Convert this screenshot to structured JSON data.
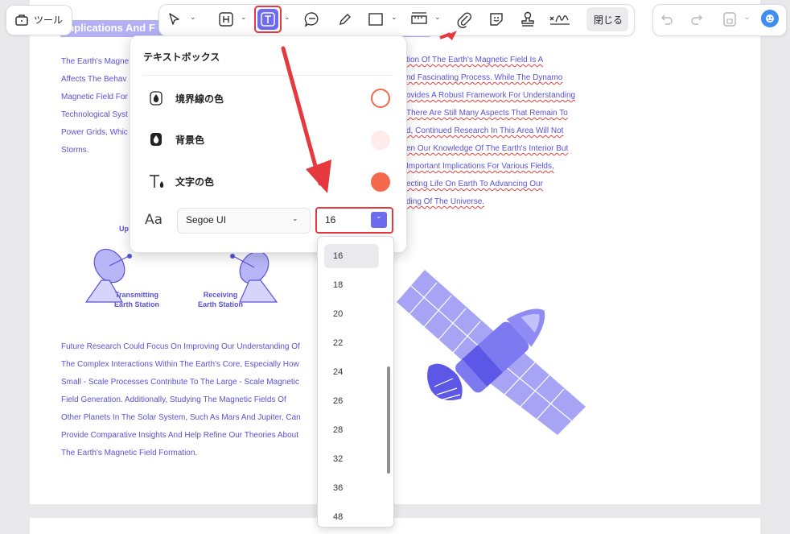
{
  "toolbar": {
    "tools_label": "ツール",
    "close_label": "閉じる"
  },
  "document": {
    "heading": "Implications And F",
    "left_para": [
      "The Earth's Magne",
      "Affects The Behav",
      "Magnetic Field For",
      "Technological Syst",
      "Power Grids, Whic",
      "Storms."
    ],
    "right_para": [
      "tion Of The Earth's Magnetic Field Is A",
      "nd Fascinating Process. While The Dynamo",
      "ovides A Robust Framework For Understanding",
      "There Are Still Many Aspects That Remain To",
      "d, Continued Research In This Area Will Not",
      "en Our Knowledge Of The Earth's Interior But",
      "Important Implications For Various Fields,",
      "ecting Life On Earth To Advancing Our",
      "ding Of The Universe."
    ],
    "diagram_top": "Up",
    "transmitting_label": [
      "Transmitting",
      "Earth Station"
    ],
    "receiving_label": [
      "Receiving",
      "Earth Station"
    ],
    "bottom_para": [
      "Future Research Could Focus On Improving Our Understanding Of",
      "The Complex Interactions Within The Earth's Core, Especially How",
      "Small - Scale Processes Contribute To The Large - Scale Magnetic",
      "Field Generation. Additionally, Studying The Magnetic Fields Of",
      "Other Planets In The Solar System, Such As Mars And Jupiter, Can",
      "Provide Comparative Insights And Help Refine Our Theories About",
      "The Earth's Magnetic Field Formation."
    ]
  },
  "textbox_panel": {
    "title": "テキストボックス",
    "border_color_label": "境界線の色",
    "background_color_label": "背景色",
    "text_color_label": "文字の色",
    "font_name": "Segoe UI",
    "font_size": "16",
    "colors": {
      "border": "#f26a4b",
      "background": "#fdeceb",
      "text": "#f26a4b"
    }
  },
  "font_size_options": [
    "16",
    "18",
    "20",
    "22",
    "24",
    "26",
    "28",
    "32",
    "36",
    "48"
  ],
  "colors": {
    "accent": "#6d6cf0",
    "highlight": "#e5393d",
    "text_blue": "#5a52d6"
  }
}
